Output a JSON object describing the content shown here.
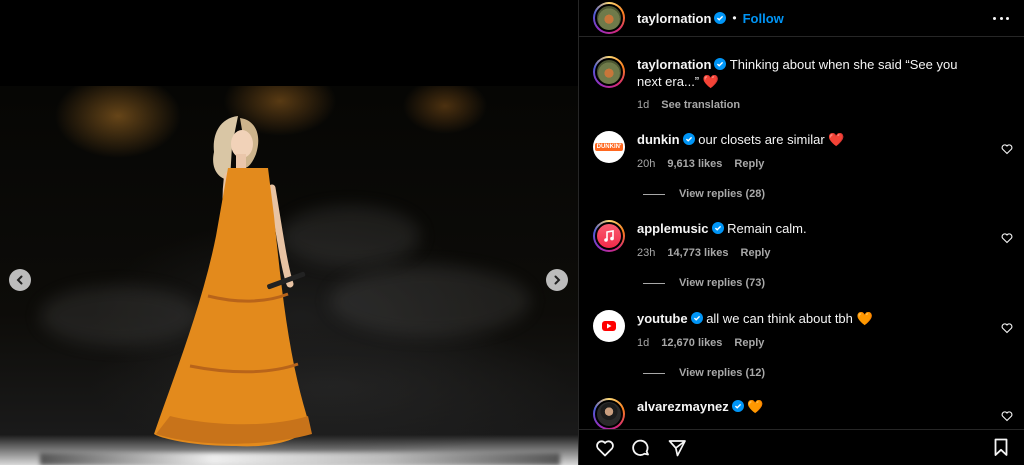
{
  "post": {
    "username": "taylornation",
    "follow_label": "Follow",
    "separator": "•",
    "caption_text": "Thinking about when she said “See you next era...” ❤️",
    "caption_time": "1d",
    "see_translation": "See translation"
  },
  "comments": [
    {
      "username": "dunkin",
      "text": "our closets are similar ❤️",
      "time": "20h",
      "likes": "9,613 likes",
      "reply": "Reply",
      "view_replies": "View replies (28)"
    },
    {
      "username": "applemusic",
      "text": "Remain calm.",
      "time": "23h",
      "likes": "14,773 likes",
      "reply": "Reply",
      "view_replies": "View replies (73)"
    },
    {
      "username": "youtube",
      "text": "all we can think about tbh 🧡",
      "time": "1d",
      "likes": "12,670 likes",
      "reply": "Reply",
      "view_replies": "View replies (12)"
    },
    {
      "username": "alvarezmaynez",
      "text": "🧡"
    }
  ],
  "logos": {
    "dunkin": "DUNKIN'"
  },
  "icons": {
    "prev": "chevron-left-icon",
    "next": "chevron-right-icon",
    "verified": "verified-badge-icon",
    "more": "more-options-icon",
    "like": "heart-icon",
    "comment": "comment-icon",
    "share": "share-icon",
    "save": "bookmark-icon",
    "music": "music-note-icon",
    "play": "play-icon"
  },
  "colors": {
    "accent": "#0095f6",
    "verified": "#0095f6",
    "secondary_text": "#a8a8a8"
  }
}
